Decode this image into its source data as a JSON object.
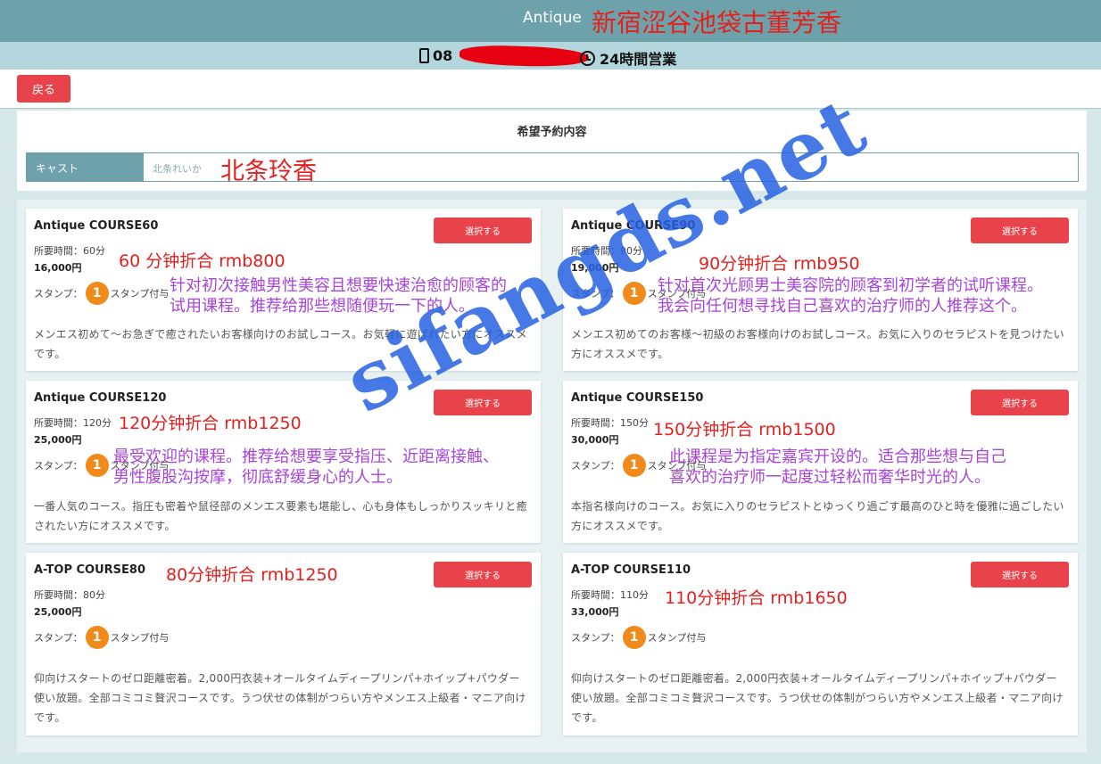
{
  "header": {
    "brand": "Antique",
    "overlay_title": "新宿涩谷池袋古董芳香",
    "phone_visible": "08",
    "hours": "24時間営業"
  },
  "nav": {
    "back_label": "戻る"
  },
  "request": {
    "title": "希望予約内容",
    "cast_label": "キャスト",
    "cast_value": "北条れいか",
    "cast_overlay": "北条玲香"
  },
  "courses": [
    {
      "name": "Antique COURSE60",
      "button": "選択する",
      "duration": "所要時間：60分",
      "price": "16,000円",
      "stamp_label": "スタンプ：",
      "stamp_count": "1",
      "stamp_suffix": "スタンプ付与",
      "description": "メンエス初めて〜お急ぎで癒されたいお客様向けのお試しコース。お気軽に遊ばれたい方にオススメです。",
      "overlay_price": "60 分钟折合  rmb800",
      "overlay_desc": [
        "针对初次接触男性美容且想要快速治愈的顾客的",
        "试用课程。推荐给那些想随便玩一下的人。"
      ]
    },
    {
      "name": "Antique COURSE90",
      "button": "選択する",
      "duration": "所要時間：90分",
      "price": "19,000円",
      "stamp_label": "スタンプ：",
      "stamp_count": "1",
      "stamp_suffix": "スタンプ付与",
      "description": "メンエス初めてのお客様〜初級のお客様向けのお試しコース。お気に入りのセラピストを見つけたい方にオススメです。",
      "overlay_price": "90分钟折合  rmb950",
      "overlay_desc": [
        "针对首次光顾男士美容院的顾客到初学者的试听课程。",
        "我会向任何想寻找自己喜欢的治疗师的人推荐这个。"
      ]
    },
    {
      "name": "Antique COURSE120",
      "button": "選択する",
      "duration": "所要時間：120分",
      "price": "25,000円",
      "stamp_label": "スタンプ：",
      "stamp_count": "1",
      "stamp_suffix": "スタンプ付与",
      "description": "一番人気のコース。指圧も密着や鼠径部のメンエス要素も堪能し、心も身体もしっかりスッキリと癒されたい方にオススメです。",
      "overlay_price": "120分钟折合  rmb1250",
      "overlay_desc": [
        "最受欢迎的课程。推荐给想要享受指压、近距离接触、",
        "男性腹股沟按摩，彻底舒缓身心的人士。"
      ]
    },
    {
      "name": "Antique COURSE150",
      "button": "選択する",
      "duration": "所要時間：150分",
      "price": "30,000円",
      "stamp_label": "スタンプ：",
      "stamp_count": "1",
      "stamp_suffix": "スタンプ付与",
      "description": "本指名様向けのコース。お気に入りのセラピストとゆっくり過ごす最高のひと時を優雅に過ごしたい方にオススメです。",
      "overlay_price": "150分钟折合  rmb1500",
      "overlay_desc": [
        "此课程是为指定嘉宾开设的。适合那些想与自己",
        "喜欢的治疗师一起度过轻松而奢华时光的人。"
      ]
    },
    {
      "name": "A-TOP COURSE80",
      "button": "選択する",
      "duration": "所要時間：80分",
      "price": "25,000円",
      "stamp_label": "スタンプ：",
      "stamp_count": "1",
      "stamp_suffix": "スタンプ付与",
      "description": "仰向けスタートのゼロ距離密着。2,000円衣装+オールタイムディープリンパ+ホイップ+パウダー使い放題。全部コミコミ贅沢コースです。うつ伏せの体制がつらい方やメンエス上級者・マニア向けです。",
      "overlay_price": "80分钟折合  rmb1250",
      "overlay_desc": []
    },
    {
      "name": "A-TOP COURSE110",
      "button": "選択する",
      "duration": "所要時間：110分",
      "price": "33,000円",
      "stamp_label": "スタンプ：",
      "stamp_count": "1",
      "stamp_suffix": "スタンプ付与",
      "description": "仰向けスタートのゼロ距離密着。2,000円衣装+オールタイムディープリンパ+ホイップ+パウダー使い放題。全部コミコミ贅沢コースです。うつ伏せの体制がつらい方やメンエス上級者・マニア向けです。",
      "overlay_price": "110分钟折合  rmb1650",
      "overlay_desc": []
    }
  ],
  "watermark": "sifangds.net"
}
